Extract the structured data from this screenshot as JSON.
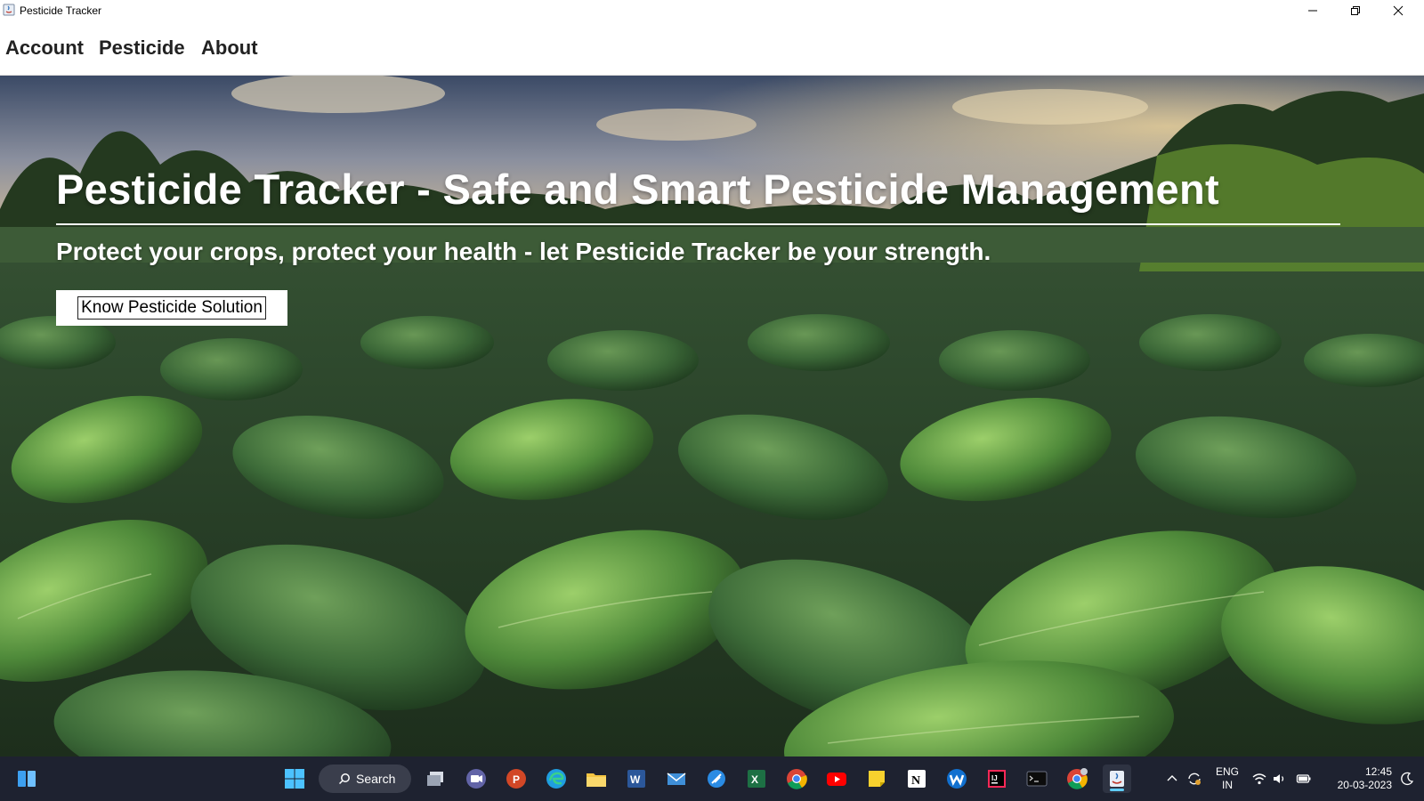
{
  "window": {
    "title": "Pesticide Tracker"
  },
  "menu": {
    "items": [
      "Account",
      "Pesticide",
      "About"
    ]
  },
  "hero": {
    "title": "Pesticide Tracker - Safe and Smart Pesticide Management",
    "subtitle": "Protect your crops, protect your health - let Pesticide Tracker be your strength.",
    "button_label": "Know Pesticide Solution"
  },
  "taskbar": {
    "search_label": "Search",
    "apps": [
      "start-icon",
      "task-view-icon",
      "teams-icon",
      "powerpoint-icon",
      "edge-icon",
      "file-explorer-icon",
      "word-icon",
      "mail-icon",
      "browser-icon",
      "excel-icon",
      "chrome-icon",
      "youtube-icon",
      "sticky-notes-icon",
      "notion-icon",
      "webex-icon",
      "intellij-icon",
      "terminal-icon",
      "chrome-profile-icon",
      "java-app-icon"
    ],
    "language": "ENG",
    "region": "IN",
    "time": "12:45",
    "date": "20-03-2023"
  },
  "colors": {
    "taskbar_bg": "#1e2230",
    "accent": "#60cdff",
    "hero_text": "#ffffff"
  }
}
